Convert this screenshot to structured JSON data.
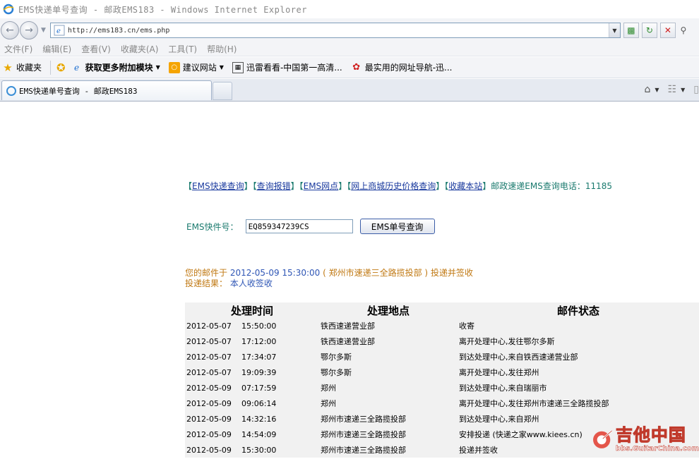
{
  "window": {
    "title": "EMS快递单号查询 - 邮政EMS183 - Windows Internet Explorer"
  },
  "address_bar": {
    "url": "http://ems183.cn/ems.php"
  },
  "menu": [
    "文件(F)",
    "编辑(E)",
    "查看(V)",
    "收藏夹(A)",
    "工具(T)",
    "帮助(H)"
  ],
  "favorites_bar": {
    "favorites": "收藏夹",
    "addons": "获取更多附加模块",
    "suggested": "建议网站",
    "item1": "迅雷看看-中国第一高清...",
    "item2": "最实用的网址导航-迅..."
  },
  "tab": {
    "label": "EMS快递单号查询 - 邮政EMS183"
  },
  "page": {
    "links": [
      "EMS快递查询",
      "查询报错",
      "EMS网点",
      "网上商城历史价格查询",
      "收藏本站"
    ],
    "hotline": "邮政速递EMS查询电话：11185",
    "search_label": "EMS快件号：",
    "tracking_number": "EQ859347239CS",
    "search_button": "EMS单号查询",
    "result_prefix": "您的邮件于",
    "result_datetime": "2012-05-09 15:30:00",
    "result_place": "( 郑州市速递三全路揽投部 )",
    "result_status": "投递并签收",
    "delivery_label": "投递结果：",
    "delivery_value": "本人收签收"
  },
  "table": {
    "headers": [
      "处理时间",
      "处理地点",
      "邮件状态"
    ],
    "rows": [
      {
        "date": "2012-05-07",
        "time": "15:50:00",
        "place": "铁西速递营业部",
        "status": "收寄"
      },
      {
        "date": "2012-05-07",
        "time": "17:12:00",
        "place": "铁西速递营业部",
        "status": "离开处理中心,发往鄂尔多斯"
      },
      {
        "date": "2012-05-07",
        "time": "17:34:07",
        "place": "鄂尔多斯",
        "status": "到达处理中心,来自铁西速递营业部"
      },
      {
        "date": "2012-05-07",
        "time": "19:09:39",
        "place": "鄂尔多斯",
        "status": "离开处理中心,发往郑州"
      },
      {
        "date": "2012-05-09",
        "time": "07:17:59",
        "place": "郑州",
        "status": "到达处理中心,来自瑞丽市"
      },
      {
        "date": "2012-05-09",
        "time": "09:06:14",
        "place": "郑州",
        "status": "离开处理中心,发往郑州市速递三全路揽投部"
      },
      {
        "date": "2012-05-09",
        "time": "14:32:16",
        "place": "郑州市速递三全路揽投部",
        "status": "到达处理中心,来自郑州"
      },
      {
        "date": "2012-05-09",
        "time": "14:54:09",
        "place": "郑州市速递三全路揽投部",
        "status": "安排投递 (快递之家www.kiees.cn)"
      },
      {
        "date": "2012-05-09",
        "time": "15:30:00",
        "place": "郑州市速递三全路揽投部",
        "status": "投递并签收"
      }
    ]
  },
  "watermark": {
    "cn": "吉他中国",
    "en": "bbs.GuitarChina.com"
  }
}
